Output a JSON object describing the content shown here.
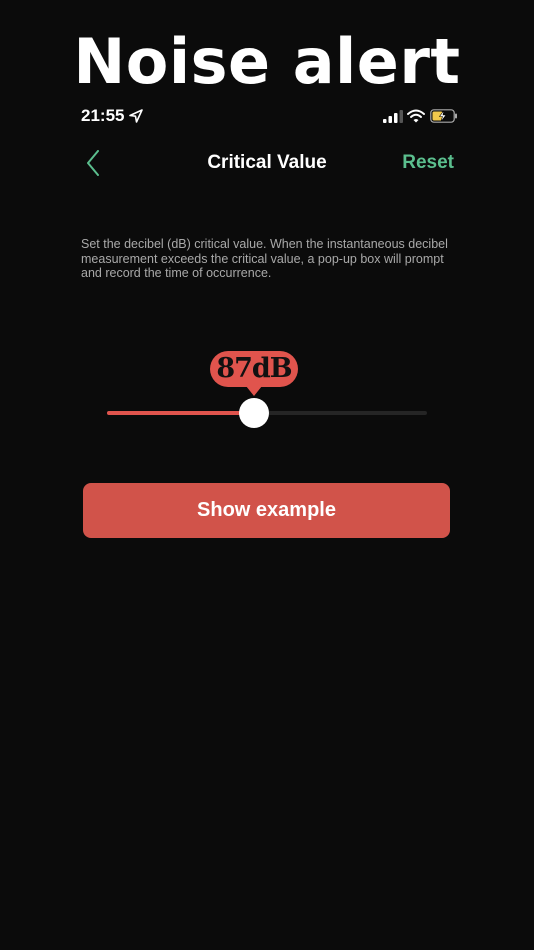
{
  "banner": {
    "title": "Noise alert"
  },
  "status_bar": {
    "time": "21:55",
    "icons": [
      "location-arrow-icon",
      "cellular-signal-icon",
      "wifi-icon",
      "battery-charging-icon"
    ]
  },
  "nav": {
    "back_icon": "chevron-left-icon",
    "title": "Critical Value",
    "reset_label": "Reset"
  },
  "description": "Set the decibel (dB) critical value. When the instantaneous decibel measurement exceeds the critical value, a pop-up box will prompt and record the time of occurrence.",
  "slider": {
    "value_label": "87dB",
    "fraction": 0.46
  },
  "actions": {
    "show_example_label": "Show example"
  },
  "colors": {
    "background": "#0b0b0b",
    "accent_red": "#e0544d",
    "button_red": "#d1534a",
    "reset_green": "#5bbf8e",
    "description_gray": "#a9a9a9"
  }
}
